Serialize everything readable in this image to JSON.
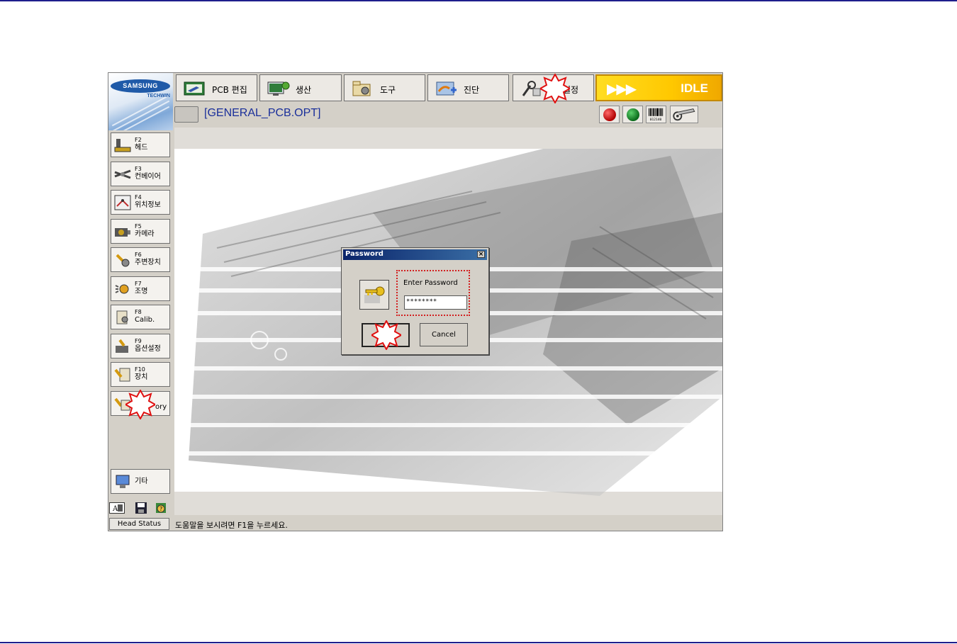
{
  "brand": {
    "logo_main": "SAMSUNG",
    "logo_sub": "TECHWIN"
  },
  "tabs": [
    {
      "label": "PCB 편집",
      "icon": "pcb-edit-icon"
    },
    {
      "label": "생산",
      "icon": "production-icon"
    },
    {
      "label": "도구",
      "icon": "tools-icon"
    },
    {
      "label": "진단",
      "icon": "diagnosis-icon"
    },
    {
      "label": "설정",
      "icon": "settings-icon"
    }
  ],
  "status": {
    "arrows": "▶▶▶",
    "state": "IDLE"
  },
  "file": {
    "name": "[GENERAL_PCB.OPT]",
    "barcode_text": "012140"
  },
  "side_buttons": [
    {
      "key": "F2",
      "label": "헤드"
    },
    {
      "key": "F3",
      "label": "컨베이어"
    },
    {
      "key": "F4",
      "label": "위치정보"
    },
    {
      "key": "F5",
      "label": "카메라"
    },
    {
      "key": "F6",
      "label": "주변장치"
    },
    {
      "key": "F7",
      "label": "조명"
    },
    {
      "key": "F8",
      "label": "Calib."
    },
    {
      "key": "F9",
      "label": "옵션설정"
    },
    {
      "key": "F10",
      "label": "장치"
    },
    {
      "key": "",
      "label": "ory"
    }
  ],
  "other_button": {
    "label": "기타"
  },
  "footer": {
    "head_status": "Head Status",
    "help": "도움말을 보시려면 F1을 누르세요."
  },
  "dialog": {
    "title": "Password",
    "close": "×",
    "prompt": "Enter Password",
    "value": "********",
    "cancel": "Cancel"
  },
  "colors": {
    "accent": "#1a2f9a",
    "idle": "#ffc800",
    "highlight": "#d22020"
  }
}
